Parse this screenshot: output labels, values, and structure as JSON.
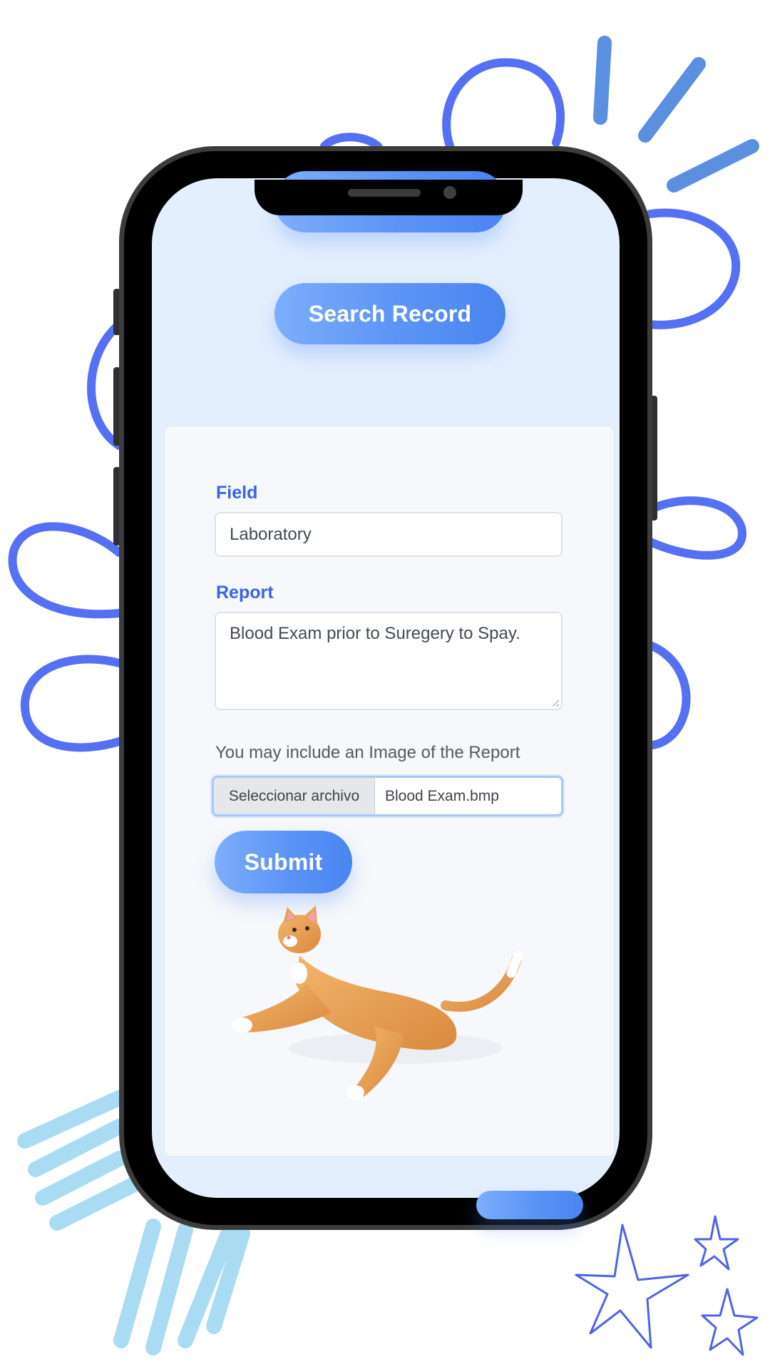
{
  "colors": {
    "accent": "#4a84f0",
    "label": "#3a63e8",
    "screen_bg": "#e4effd",
    "card_bg": "#f6f8fb",
    "doodle_blue": "#5570f2",
    "doodle_light": "#a9dcf2"
  },
  "toolbar": {
    "search_label": "Search Record"
  },
  "form": {
    "field_label": "Field",
    "field_value": "Laboratory",
    "report_label": "Report",
    "report_value": "Blood Exam prior to Suregery to Spay.",
    "image_hint": "You may include an Image of the Report",
    "file_button_label": "Seleccionar archivo",
    "file_name": "Blood Exam.bmp",
    "submit_label": "Submit"
  },
  "illustration": {
    "name": "cat-illustration"
  }
}
